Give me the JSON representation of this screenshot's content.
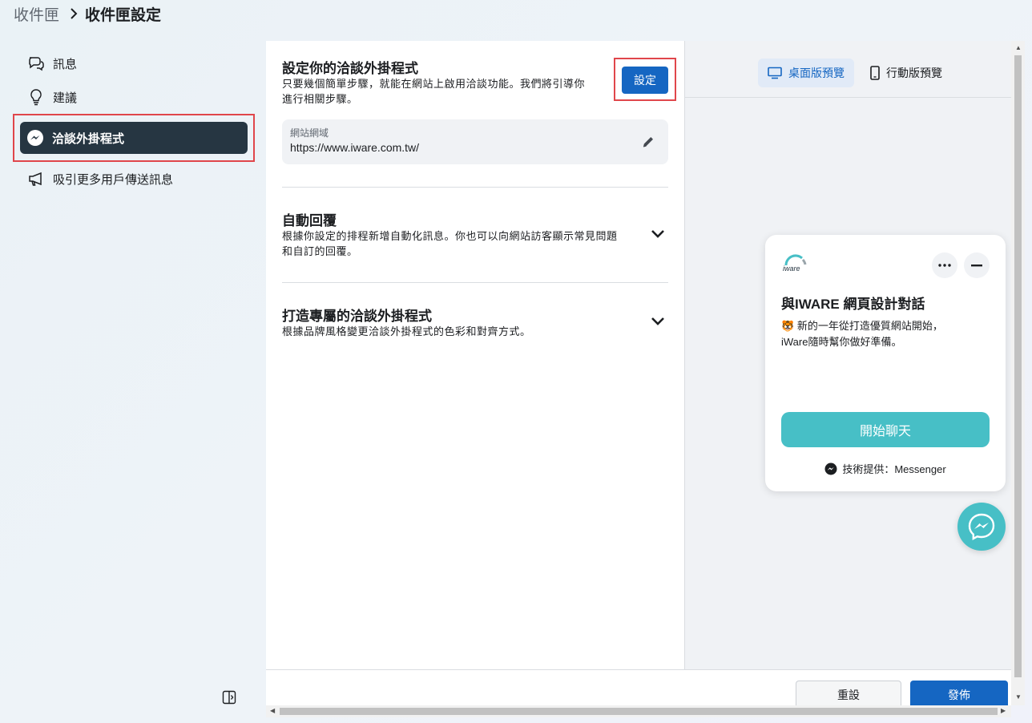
{
  "breadcrumb": {
    "parent": "收件匣",
    "current": "收件匣設定"
  },
  "sidebar": {
    "items": [
      {
        "label": "訊息",
        "icon": "chat-bubbles-icon"
      },
      {
        "label": "建議",
        "icon": "lightbulb-icon"
      },
      {
        "label": "洽談外掛程式",
        "icon": "messenger-icon",
        "active": true
      },
      {
        "label": "吸引更多用戶傳送訊息",
        "icon": "megaphone-icon"
      }
    ]
  },
  "setup": {
    "title": "設定你的洽談外掛程式",
    "desc_line1": "只要幾個簡單步驟，就能在網站上啟用洽談功能。我們將引導你",
    "desc_line2": "進行相關步驟。",
    "button": "設定",
    "domain_label": "網站網域",
    "domain_value": "https://www.iware.com.tw/"
  },
  "auto_reply": {
    "title": "自動回覆",
    "desc_line1": "根據你設定的排程新增自動化訊息。你也可以向網站訪客顯示常見問題",
    "desc_line2": "和自訂的回覆。"
  },
  "customize": {
    "title": "打造專屬的洽談外掛程式",
    "desc": "根據品牌風格變更洽談外掛程式的色彩和對齊方式。"
  },
  "preview": {
    "desktop_tab": "桌面版預覽",
    "mobile_tab": "行動版預覽",
    "chat_title": "與IWARE 網頁設計對話",
    "chat_emoji": "🐯",
    "chat_msg_line1": "新的一年從打造優質網站開始，",
    "chat_msg_line2": "iWare隨時幫你做好準備。",
    "start_button": "開始聊天",
    "powered_by": "技術提供：Messenger",
    "logo_text": "iware"
  },
  "footer": {
    "reset": "重設",
    "publish": "發佈"
  },
  "colors": {
    "accent": "#1566c2",
    "active_nav": "#263642",
    "chat_teal": "#47bfc6",
    "highlight_red": "#e0464b"
  }
}
